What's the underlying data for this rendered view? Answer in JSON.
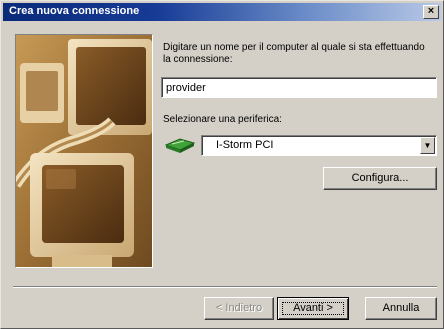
{
  "window": {
    "title": "Crea nuova connessione",
    "close_glyph": "×"
  },
  "form": {
    "prompt": "Digitare un nome per il computer al quale si sta effettuando la connessione:",
    "name_value": "provider",
    "device_label": "Selezionare una periferica:",
    "device_selected": "I-Storm PCI",
    "configure_label": "Configura..."
  },
  "buttons": {
    "back": "< Indietro",
    "next": "Avanti >",
    "cancel": "Annulla"
  },
  "icons": {
    "modem": "modem-icon",
    "select_arrow": "chevron-down-icon",
    "illustration": "computer-monitors-illustration"
  }
}
